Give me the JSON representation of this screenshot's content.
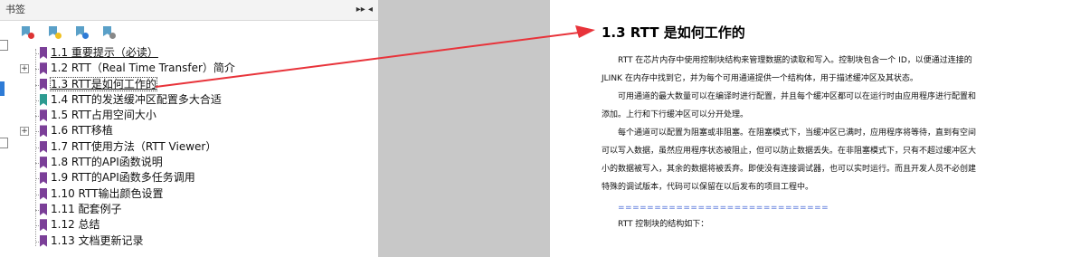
{
  "panel": {
    "title": "书签",
    "controls": "▸▸ ◂"
  },
  "bookmarks": [
    {
      "label": "1.1 重要提示（必读）",
      "underline": true
    },
    {
      "label": "1.2 RTT（Real Time Transfer）简介",
      "expandable": true
    },
    {
      "label": "1.3 RTT是如何工作的",
      "underline": true,
      "selected": true
    },
    {
      "label": "1.4 RTT的发送缓冲区配置多大合适",
      "teal": true
    },
    {
      "label": "1.5 RTT占用空间大小"
    },
    {
      "label": "1.6 RTT移植",
      "expandable": true
    },
    {
      "label": "1.7 RTT使用方法（RTT Viewer）"
    },
    {
      "label": "1.8 RTT的API函数说明"
    },
    {
      "label": "1.9 RTT的API函数多任务调用"
    },
    {
      "label": "1.10 RTT输出颜色设置"
    },
    {
      "label": "1.11 配套例子"
    },
    {
      "label": "1.12 总结"
    },
    {
      "label": "1.13 文档更新记录"
    }
  ],
  "document": {
    "heading": "1.3 RTT 是如何工作的",
    "lines": [
      "RTT 在芯片内存中使用控制块结构来管理数据的读取和写入。控制块包含一个 ID，以便通过连接的",
      "JLINK 在内存中找到它，并为每个可用通道提供一个结构体，用于描述缓冲区及其状态。",
      "可用通道的最大数量可以在编译时进行配置，并且每个缓冲区都可以在运行时由应用程序进行配置和",
      "添加。上行和下行缓冲区可以分开处理。",
      "每个通道可以配置为阻塞或非阻塞。在阻塞模式下，当缓冲区已满时，应用程序将等待，直到有空间",
      "可以写入数据，虽然应用程序状态被阻止，但可以防止数据丢失。在非阻塞模式下，只有不超过缓冲区大",
      "小的数据被写入，其余的数据将被丢弃。即使没有连接调试器，也可以实时运行。而且开发人员不必创建",
      "特殊的调试版本，代码可以保留在以后发布的项目工程中。",
      "=============================",
      "RTT 控制块的结构如下："
    ]
  },
  "colors": {
    "arrow": "#e8333a",
    "bookmark": "#7b3f98",
    "bookmark_alt": "#2d9b91",
    "separator": "#4a6bd8"
  }
}
